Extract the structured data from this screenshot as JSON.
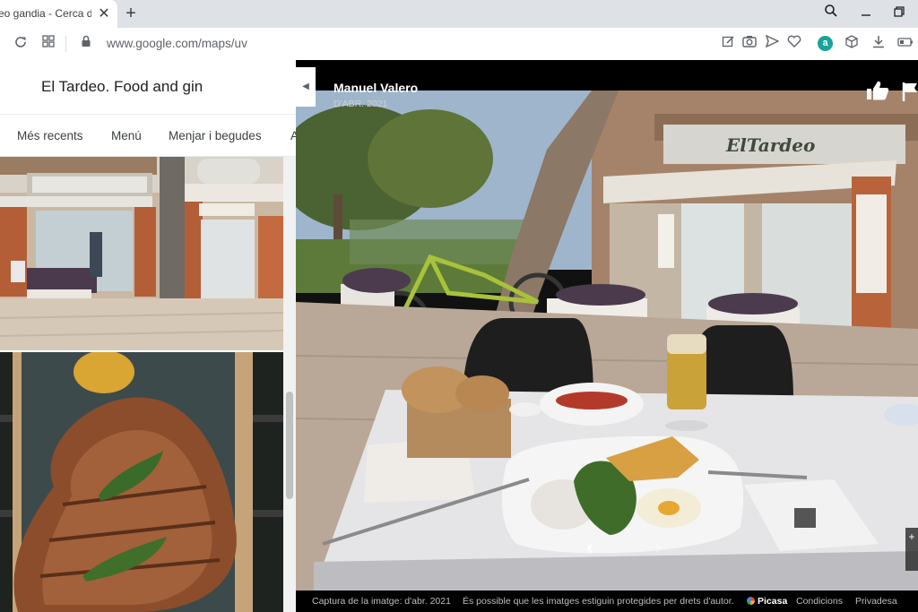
{
  "browser": {
    "tab_title": "eo gandia - Cerca de",
    "close_glyph": "✕",
    "new_tab_glyph": "+",
    "url": "www.google.com/maps/uv",
    "extension_badge": "a"
  },
  "panel": {
    "title": "El Tardeo. Food and gin",
    "tabs": [
      {
        "label": "Més recents"
      },
      {
        "label": "Menú"
      },
      {
        "label": "Menjar i begudes"
      },
      {
        "label": "A"
      }
    ]
  },
  "viewer": {
    "author": "Manuel Valero",
    "date": "D'ABR. 2021",
    "prev": "‹",
    "next": "›",
    "zoom": "+",
    "sign_text": "ElTardeo",
    "footer": {
      "capture": "Captura de la imatge: d'abr. 2021",
      "copyright": "És possible que les imatges estiguin protegides per drets d'autor.",
      "source": "Picasa",
      "terms": "Condicions",
      "privacy": "Privadesa"
    }
  },
  "colors": {
    "tabbar": "#dee1e6",
    "viewer_bg": "#111111",
    "extension": "#1aa39a"
  },
  "icons": [
    "reload-icon",
    "apps-icon",
    "lock-icon",
    "edit-icon",
    "camera-icon",
    "send-icon",
    "heart-icon",
    "cube-icon",
    "download-icon",
    "battery-icon",
    "search-icon",
    "minimize-icon",
    "restore-icon",
    "thumbs-up-icon",
    "flag-icon"
  ]
}
